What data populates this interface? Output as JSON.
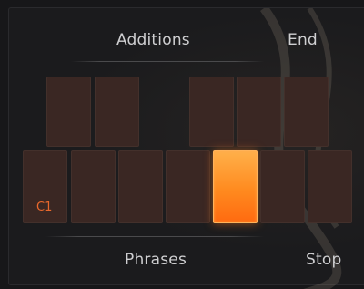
{
  "top_labels": {
    "left": "Additions",
    "right": "End"
  },
  "bottom_labels": {
    "left": "Phrases",
    "right": "Stop"
  },
  "keyboard": {
    "start_note_label": "C1",
    "active_key_index": 4,
    "white_key_count": 7,
    "black_key_count": 5
  },
  "colors": {
    "pad_idle": "#3a2723",
    "pad_active": "#ff8a1f",
    "note_label": "#e9682c",
    "text": "#cfcfd1"
  }
}
